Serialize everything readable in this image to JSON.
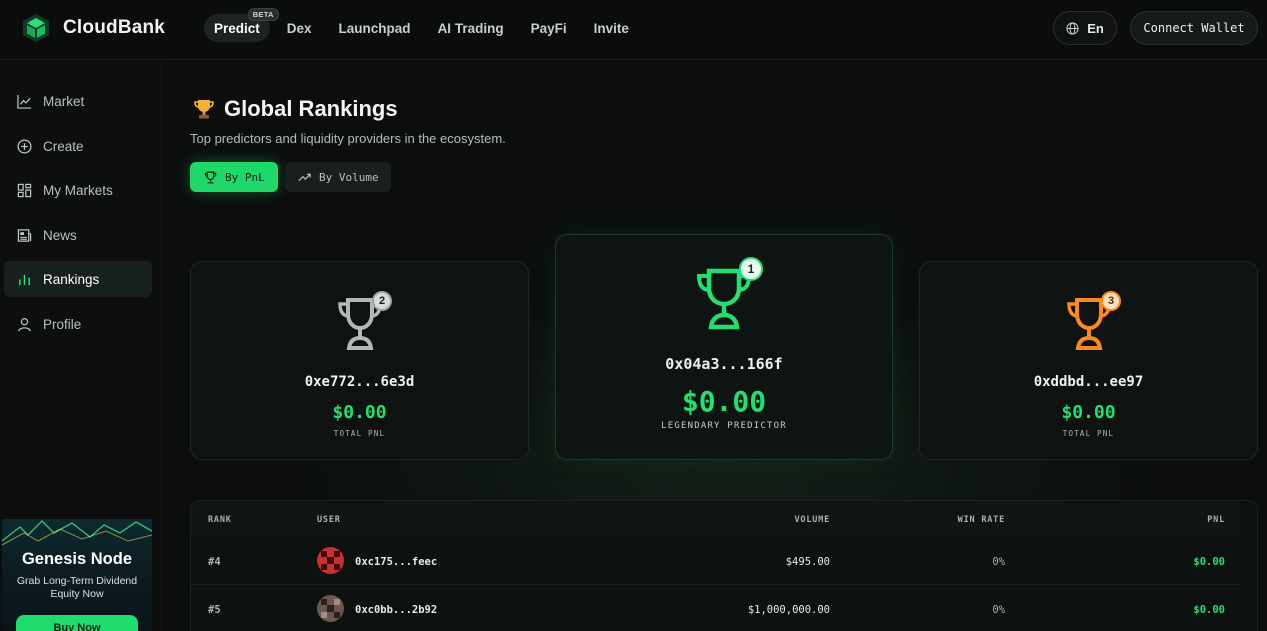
{
  "header": {
    "brand": "CloudBank",
    "nav": [
      {
        "label": "Predict",
        "badge": "BETA",
        "active": true
      },
      {
        "label": "Dex"
      },
      {
        "label": "Launchpad"
      },
      {
        "label": "AI Trading"
      },
      {
        "label": "PayFi"
      },
      {
        "label": "Invite"
      }
    ],
    "language": "En",
    "connect_wallet": "Connect Wallet"
  },
  "sidebar": {
    "items": [
      {
        "label": "Market",
        "icon": "chart-line-icon"
      },
      {
        "label": "Create",
        "icon": "plus-circle-icon"
      },
      {
        "label": "My Markets",
        "icon": "grid-icon"
      },
      {
        "label": "News",
        "icon": "newspaper-icon"
      },
      {
        "label": "Rankings",
        "icon": "bar-chart-icon",
        "active": true
      },
      {
        "label": "Profile",
        "icon": "user-icon"
      }
    ],
    "promo": {
      "title": "Genesis Node",
      "subtitle": "Grab Long-Term Dividend Equity Now",
      "button": "Buy Now"
    }
  },
  "main": {
    "title": "Global Rankings",
    "title_icon": "trophy-emoji",
    "subtitle": "Top predictors and liquidity providers in the ecosystem.",
    "tabs": [
      {
        "label": "By PnL",
        "icon": "trophy-icon",
        "active": true
      },
      {
        "label": "By Volume",
        "icon": "trend-up-icon"
      }
    ],
    "podium": {
      "first": {
        "rank": "1",
        "address": "0x04a3...166f",
        "pnl": "$0.00",
        "label": "LEGENDARY PREDICTOR"
      },
      "second": {
        "rank": "2",
        "address": "0xe772...6e3d",
        "pnl": "$0.00",
        "label": "TOTAL PNL"
      },
      "third": {
        "rank": "3",
        "address": "0xddbd...ee97",
        "pnl": "$0.00",
        "label": "TOTAL PNL"
      }
    },
    "table": {
      "headers": {
        "rank": "RANK",
        "user": "USER",
        "volume": "VOLUME",
        "win_rate": "WIN RATE",
        "pnl": "PNL"
      },
      "rows": [
        {
          "rank": "#4",
          "user": "0xc175...feec",
          "volume": "$495.00",
          "win_rate": "0%",
          "pnl": "$0.00"
        },
        {
          "rank": "#5",
          "user": "0xc0bb...2b92",
          "volume": "$1,000,000.00",
          "win_rate": "0%",
          "pnl": "$0.00"
        }
      ]
    }
  },
  "colors": {
    "accent": "#1fd86a",
    "background": "#0b0e0d",
    "silver": "#b3b8b6",
    "bronze": "#ff8a1c"
  }
}
